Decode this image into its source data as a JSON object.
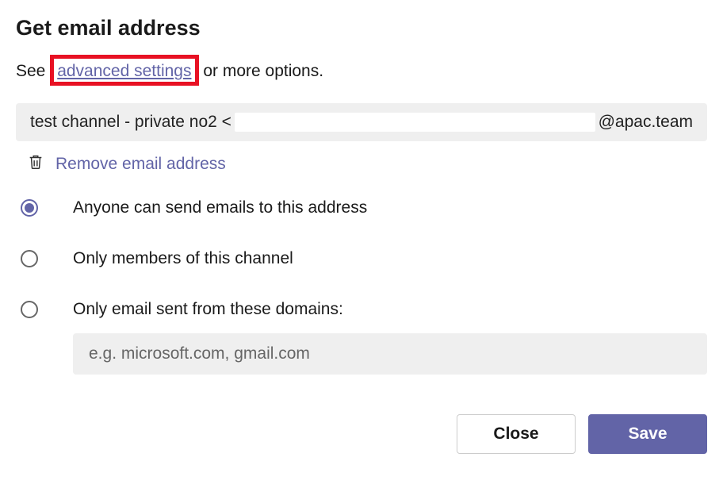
{
  "title": "Get email address",
  "subtitle_prefix": "See ",
  "advanced_settings_label": "advanced settings",
  "subtitle_suffix": " or more options.",
  "email_field": {
    "prefix": "test channel - private no2 <",
    "suffix": "@apac.team"
  },
  "remove_label": "Remove email address",
  "options": [
    {
      "label": "Anyone can send emails to this address",
      "selected": true
    },
    {
      "label": "Only members of this channel",
      "selected": false
    },
    {
      "label": "Only email sent from these domains:",
      "selected": false
    }
  ],
  "domains_placeholder": "e.g. microsoft.com, gmail.com",
  "buttons": {
    "close": "Close",
    "save": "Save"
  }
}
